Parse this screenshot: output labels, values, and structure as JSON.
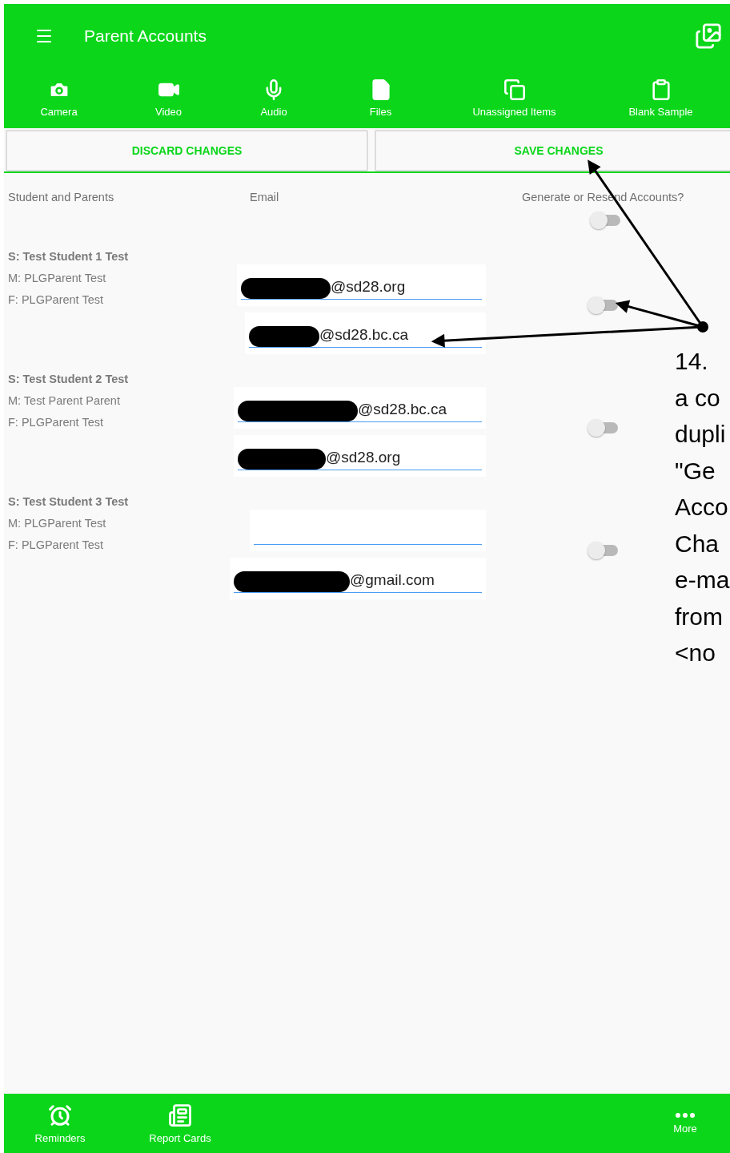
{
  "app_bar": {
    "title": "Parent Accounts"
  },
  "toolbar": [
    {
      "label": "Camera",
      "kind": "camera"
    },
    {
      "label": "Video",
      "kind": "video"
    },
    {
      "label": "Audio",
      "kind": "audio"
    },
    {
      "label": "Files",
      "kind": "files"
    },
    {
      "label": "Unassigned Items",
      "kind": "unassigned"
    },
    {
      "label": "Blank Sample",
      "kind": "clipboard"
    }
  ],
  "actions": [
    "DISCARD CHANGES",
    "SAVE CHANGES"
  ],
  "table": {
    "columns": [
      "Student and Parents",
      "Email",
      "Generate or Resend Accounts?"
    ],
    "header_toggle": {
      "on": false
    },
    "rows": [
      {
        "student": "S: Test Student 1 Test",
        "mother": "M: PLGParent Test",
        "father": "F: PLGParent Test",
        "emails": [
          {
            "value": "@sd28.org",
            "redacted": true
          },
          {
            "value": "@sd28.bc.ca",
            "redacted": true
          }
        ],
        "toggle": {
          "on": false
        }
      },
      {
        "student": "S: Test Student 2 Test",
        "mother": "M: Test Parent Parent",
        "father": "F: PLGParent Test",
        "emails": [
          {
            "value": "@sd28.bc.ca",
            "redacted": true
          },
          {
            "value": "@sd28.org",
            "redacted": true
          }
        ],
        "toggle": {
          "on": false
        }
      },
      {
        "student": "S: Test Student 3 Test",
        "mother": "M: PLGParent Test",
        "father": "F: PLGParent Test",
        "emails": [
          {
            "redacted": false
          },
          {
            "value": "@gmail.com",
            "redacted": true
          }
        ],
        "toggle": {
          "on": false
        }
      }
    ]
  },
  "annotation": {
    "lines": [
      "14.",
      "a co",
      "dupli",
      "\"Ge",
      "Acco",
      "Cha",
      "e-ma",
      "from",
      "<no"
    ]
  },
  "bottom_nav": [
    {
      "label": "Reminders",
      "kind": "alarm"
    },
    {
      "label": "Report Cards",
      "kind": "report"
    },
    {
      "label": "More",
      "kind": "more"
    }
  ]
}
